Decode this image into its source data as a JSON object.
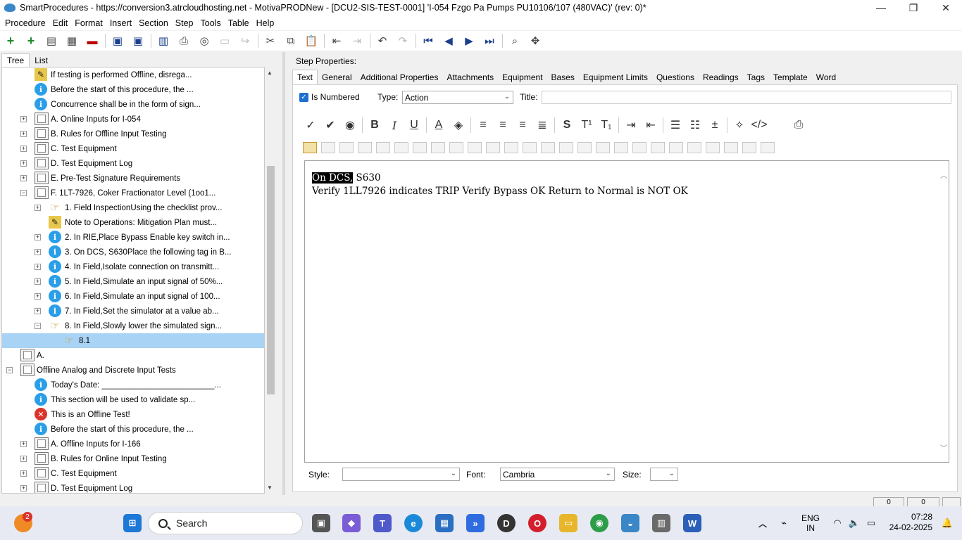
{
  "window": {
    "title": "SmartProcedures - https://conversion3.atrcloudhosting.net - MotivaPRODNew - [DCU2-SIS-TEST-0001] 'I-054 Fzgo Pa Pumps PU10106/107 (480VAC)' (rev: 0)*",
    "minimize": "—",
    "maximize": "❐",
    "close": "✕"
  },
  "menu": [
    "Procedure",
    "Edit",
    "Format",
    "Insert",
    "Section",
    "Step",
    "Tools",
    "Table",
    "Help"
  ],
  "left_tabs": {
    "tree": "Tree",
    "list": "List"
  },
  "tree": [
    {
      "indent": 3,
      "icon": "warn-icon",
      "expander": "",
      "text": "If testing is performed Offline, disrega..."
    },
    {
      "indent": 3,
      "icon": "info-icon",
      "expander": "",
      "text": "Before the start of this procedure, the ..."
    },
    {
      "indent": 3,
      "icon": "info-icon",
      "expander": "",
      "text": "Concurrence shall be in the form of sign..."
    },
    {
      "indent": 3,
      "icon": "section-icon",
      "expander": "+",
      "text": "A. Online Inputs for I-054"
    },
    {
      "indent": 3,
      "icon": "section-icon",
      "expander": "+",
      "text": "B. Rules for Offline Input Testing"
    },
    {
      "indent": 3,
      "icon": "section-icon",
      "expander": "+",
      "text": "C. Test Equipment"
    },
    {
      "indent": 3,
      "icon": "section-icon",
      "expander": "+",
      "text": "D. Test Equipment Log"
    },
    {
      "indent": 3,
      "icon": "section-icon",
      "expander": "+",
      "text": "E. Pre-Test Signature Requirements"
    },
    {
      "indent": 3,
      "icon": "section-icon",
      "expander": "−",
      "text": "F. 1LT-7926, Coker Fractionator Level (1oo1..."
    },
    {
      "indent": 4,
      "icon": "hand-icon",
      "expander": "+",
      "text": "1. Field InspectionUsing the checklist prov..."
    },
    {
      "indent": 4,
      "icon": "warn-icon",
      "expander": "",
      "text": "Note to Operations: Mitigation Plan must..."
    },
    {
      "indent": 4,
      "icon": "info-icon",
      "expander": "+",
      "text": "2. In RIE,Place Bypass Enable key switch in..."
    },
    {
      "indent": 4,
      "icon": "info-icon",
      "expander": "+",
      "text": "3. On DCS, S630Place the following tag in B..."
    },
    {
      "indent": 4,
      "icon": "info-icon",
      "expander": "+",
      "text": "4. In Field,Isolate connection on transmitt..."
    },
    {
      "indent": 4,
      "icon": "info-icon",
      "expander": "+",
      "text": "5. In Field,Simulate an input signal of 50%..."
    },
    {
      "indent": 4,
      "icon": "info-icon",
      "expander": "+",
      "text": "6. In Field,Simulate an input signal of 100..."
    },
    {
      "indent": 4,
      "icon": "info-icon",
      "expander": "+",
      "text": "7. In Field,Set the simulator at a value ab..."
    },
    {
      "indent": 4,
      "icon": "hand-icon",
      "expander": "−",
      "text": "8. In Field,Slowly lower the simulated sign..."
    },
    {
      "indent": 5,
      "icon": "hand-icon",
      "expander": "",
      "text": "8.1",
      "selected": true
    },
    {
      "indent": 2,
      "icon": "section-icon",
      "expander": "",
      "text": "A."
    },
    {
      "indent": 2,
      "icon": "section-icon",
      "expander": "−",
      "text": "Offline Analog and Discrete Input Tests"
    },
    {
      "indent": 3,
      "icon": "info-icon",
      "expander": "",
      "text": "Today's Date: _________________________..."
    },
    {
      "indent": 3,
      "icon": "info-icon",
      "expander": "",
      "text": "This section will be used to validate sp..."
    },
    {
      "indent": 3,
      "icon": "error-icon",
      "expander": "",
      "text": "This is an Offline Test!"
    },
    {
      "indent": 3,
      "icon": "info-icon",
      "expander": "",
      "text": "Before the start of this procedure, the ..."
    },
    {
      "indent": 3,
      "icon": "section-icon",
      "expander": "+",
      "text": "A. Offline Inputs for I-166"
    },
    {
      "indent": 3,
      "icon": "section-icon",
      "expander": "+",
      "text": "B. Rules for Online Input Testing"
    },
    {
      "indent": 3,
      "icon": "section-icon",
      "expander": "+",
      "text": "C. Test Equipment"
    },
    {
      "indent": 3,
      "icon": "section-icon",
      "expander": "+",
      "text": "D. Test Equipment Log"
    }
  ],
  "step_properties": {
    "label": "Step Properties:",
    "tabs": [
      "Text",
      "General",
      "Additional Properties",
      "Attachments",
      "Equipment",
      "Bases",
      "Equipment Limits",
      "Questions",
      "Readings",
      "Tags",
      "Template",
      "Word"
    ],
    "is_numbered_label": "Is Numbered",
    "type_label": "Type:",
    "type_value": "Action",
    "title_label": "Title:",
    "title_value": ""
  },
  "editor": {
    "line1_highlight": "On DCS,",
    "line1_rest": " S630",
    "line2": "Verify 1LL7926  indicates TRIP Verify Bypass OK Return  to Normal is NOT OK"
  },
  "bottom": {
    "style_label": "Style:",
    "style_value": "",
    "font_label": "Font:",
    "font_value": "Cambria",
    "size_label": "Size:",
    "size_value": ""
  },
  "statusbar": {
    "cell1": "0",
    "cell2": "0"
  },
  "taskbar": {
    "search_placeholder": "Search",
    "notification_count": "2",
    "lang_line1": "ENG",
    "lang_line2": "IN",
    "time": "07:28",
    "date": "24-02-2025"
  },
  "colors": {
    "selection": "#a8d3f5",
    "info": "#2a9ee8",
    "error": "#d9342b",
    "accent": "#1e6fd1"
  }
}
